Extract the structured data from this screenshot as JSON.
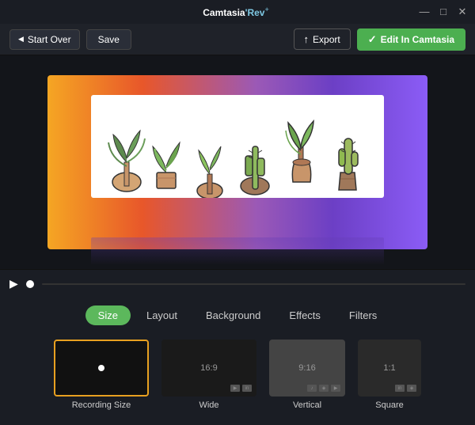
{
  "titlebar": {
    "title_camtasia": "Camtasia",
    "title_rev": "'Rev",
    "title_plus": "+",
    "minimize": "—",
    "maximize": "□",
    "close": "✕"
  },
  "toolbar": {
    "start_over": "Start Over",
    "save": "Save",
    "export": "Export",
    "edit_camtasia": "Edit In Camtasia"
  },
  "tabs": [
    {
      "id": "size",
      "label": "Size",
      "active": true
    },
    {
      "id": "layout",
      "label": "Layout",
      "active": false
    },
    {
      "id": "background",
      "label": "Background",
      "active": false
    },
    {
      "id": "effects",
      "label": "Effects",
      "active": false
    },
    {
      "id": "filters",
      "label": "Filters",
      "active": false
    }
  ],
  "size_options": [
    {
      "id": "recording",
      "label": "Recording Size",
      "ratio": "",
      "selected": true,
      "type": "recording"
    },
    {
      "id": "wide",
      "label": "Wide",
      "ratio": "16:9",
      "selected": false,
      "type": "wide"
    },
    {
      "id": "vertical",
      "label": "Vertical",
      "ratio": "9:16",
      "selected": false,
      "type": "vertical"
    },
    {
      "id": "square",
      "label": "Square",
      "ratio": "1:1",
      "selected": false,
      "type": "square"
    }
  ],
  "colors": {
    "accent_green": "#4caf50",
    "accent_orange": "#e8a020",
    "tab_active_bg": "#5cb85c"
  }
}
